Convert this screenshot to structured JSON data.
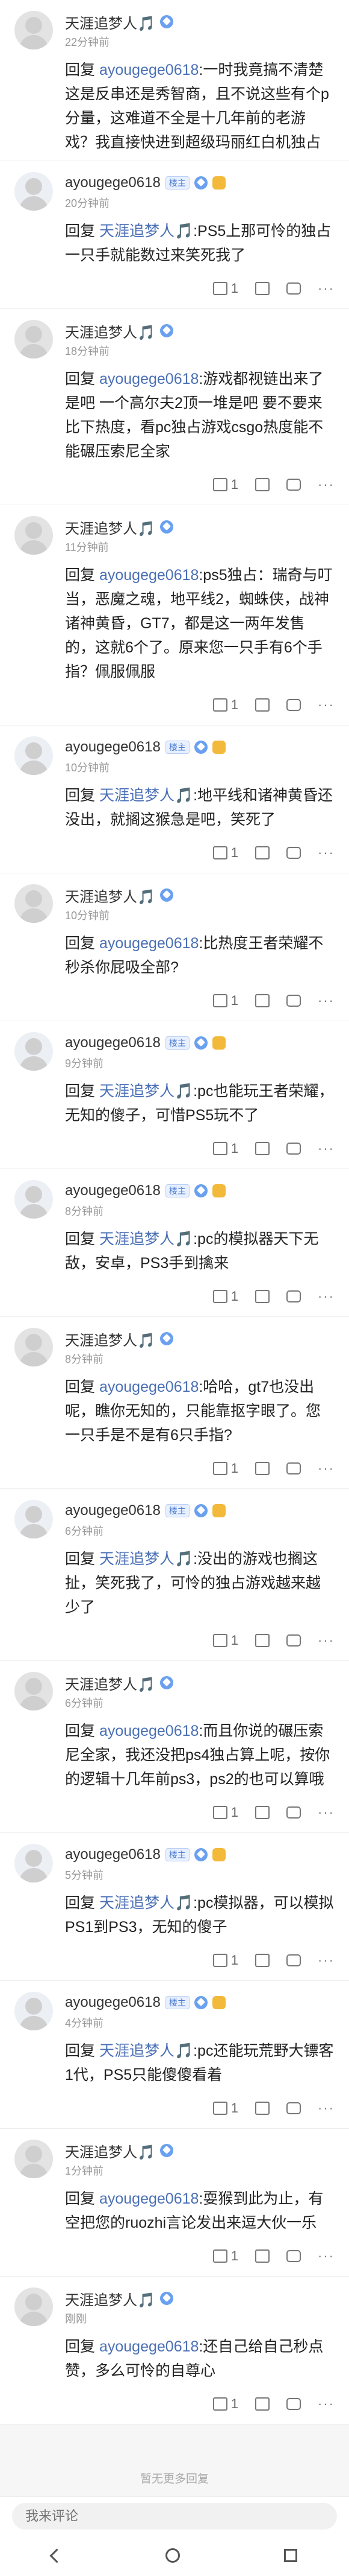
{
  "comments": [
    {
      "type": "a",
      "name": "天涯追梦人🎵",
      "time": "22分钟前",
      "reply_prefix": "回复",
      "reply_to": "ayougege0618",
      "text": ":一时我竟搞不清楚这是反串还是秀智商，且不说这些有个p分量，这难道不全是十几年前的老游戏？我直接快进到超级玛丽红白机独占",
      "likes": "",
      "show_actions": false
    },
    {
      "type": "b",
      "name": "ayougege0618",
      "time": "20分钟前",
      "reply_prefix": "回复",
      "reply_to": "天涯追梦人🎵",
      "text": ":PS5上那可怜的独占一只手就能数过来笑死我了",
      "likes": "1",
      "show_actions": true
    },
    {
      "type": "a",
      "name": "天涯追梦人🎵",
      "time": "18分钟前",
      "reply_prefix": "回复",
      "reply_to": "ayougege0618",
      "text": ":游戏都视链出来了是吧 一个高尔夫2顶一堆是吧 要不要来比下热度，看pc独占游戏csgo热度能不能碾压索尼全家",
      "likes": "1",
      "show_actions": true
    },
    {
      "type": "a",
      "name": "天涯追梦人🎵",
      "time": "11分钟前",
      "reply_prefix": "回复",
      "reply_to": "ayougege0618",
      "text": ":ps5独占：瑞奇与叮当，恶魔之魂，地平线2，蜘蛛侠，战神诸神黄昏，GT7，都是这一两年发售的，这就6个了。原来您一只手有6个手指？佩服佩服",
      "likes": "1",
      "show_actions": true
    },
    {
      "type": "b",
      "name": "ayougege0618",
      "time": "10分钟前",
      "reply_prefix": "回复",
      "reply_to": "天涯追梦人🎵",
      "text": ":地平线和诸神黄昏还没出，就搁这猴急是吧，笑死了",
      "likes": "1",
      "show_actions": true
    },
    {
      "type": "a",
      "name": "天涯追梦人🎵",
      "time": "10分钟前",
      "reply_prefix": "回复",
      "reply_to": "ayougege0618",
      "text": ":比热度王者荣耀不秒杀你屁吸全部?",
      "likes": "1",
      "show_actions": true
    },
    {
      "type": "b",
      "name": "ayougege0618",
      "time": "9分钟前",
      "reply_prefix": "回复",
      "reply_to": "天涯追梦人🎵",
      "text": ":pc也能玩王者荣耀，无知的傻子，可惜PS5玩不了",
      "likes": "1",
      "show_actions": true
    },
    {
      "type": "b",
      "name": "ayougege0618",
      "time": "8分钟前",
      "reply_prefix": "回复",
      "reply_to": "天涯追梦人🎵",
      "text": ":pc的模拟器天下无敌，安卓，PS3手到擒来",
      "likes": "1",
      "show_actions": true
    },
    {
      "type": "a",
      "name": "天涯追梦人🎵",
      "time": "8分钟前",
      "reply_prefix": "回复",
      "reply_to": "ayougege0618",
      "text": ":哈哈，gt7也没出呢，瞧你无知的，只能靠抠字眼了。您一只手是不是有6只手指?",
      "likes": "1",
      "show_actions": true
    },
    {
      "type": "b",
      "name": "ayougege0618",
      "time": "6分钟前",
      "reply_prefix": "回复",
      "reply_to": "天涯追梦人🎵",
      "text": ":没出的游戏也搁这扯，笑死我了，可怜的独占游戏越来越少了",
      "likes": "1",
      "show_actions": true
    },
    {
      "type": "a",
      "name": "天涯追梦人🎵",
      "time": "6分钟前",
      "reply_prefix": "回复",
      "reply_to": "ayougege0618",
      "text": ":而且你说的碾压索尼全家，我还没把ps4独占算上呢，按你的逻辑十几年前ps3，ps2的也可以算哦",
      "likes": "1",
      "show_actions": true
    },
    {
      "type": "b",
      "name": "ayougege0618",
      "time": "5分钟前",
      "reply_prefix": "回复",
      "reply_to": "天涯追梦人🎵",
      "text": ":pc模拟器，可以模拟PS1到PS3，无知的傻子",
      "likes": "1",
      "show_actions": true
    },
    {
      "type": "b",
      "name": "ayougege0618",
      "time": "4分钟前",
      "reply_prefix": "回复",
      "reply_to": "天涯追梦人🎵",
      "text": ":pc还能玩荒野大镖客1代，PS5只能傻傻看着",
      "likes": "1",
      "show_actions": true
    },
    {
      "type": "a",
      "name": "天涯追梦人🎵",
      "time": "1分钟前",
      "reply_prefix": "回复",
      "reply_to": "ayougege0618",
      "text": ":耍猴到此为止，有空把您的ruozhi言论发出来逗大伙一乐",
      "likes": "1",
      "show_actions": true
    },
    {
      "type": "a",
      "name": "天涯追梦人🎵",
      "time": "刚刚",
      "reply_prefix": "回复",
      "reply_to": "ayougege0618",
      "text": ":还自己给自己秒点赞，多么可怜的自尊心",
      "likes": "1",
      "show_actions": true
    }
  ],
  "badge_label": "楼主",
  "no_more": "暂无更多回复",
  "input_placeholder": "我来评论",
  "colors": {
    "link": "#4a6fb5",
    "muted": "#999999",
    "bg": "#f6f6f6"
  }
}
